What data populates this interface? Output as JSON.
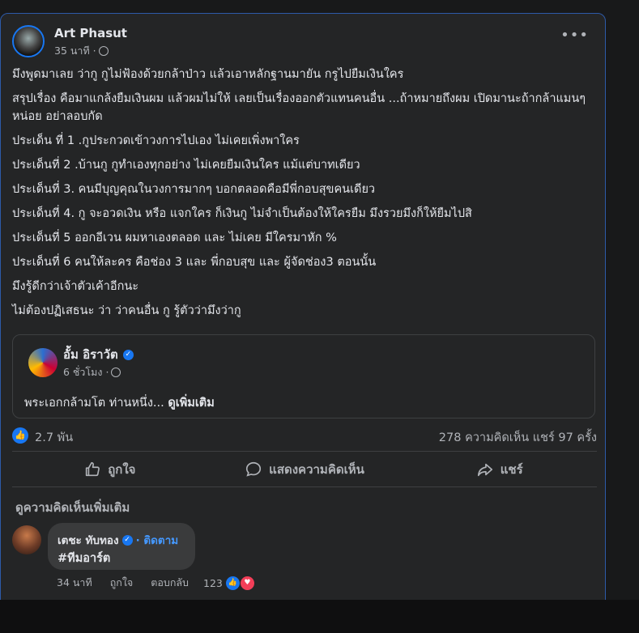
{
  "post": {
    "author": "Art Phasut",
    "time": "35 นาที ·",
    "lines": [
      "มึงพูดมาเลย ว่ากู กูไม่ฟ้องด้วยกล้าป่าว แล้วเอาหลักฐานมายัน กรูไปยืมเงินใคร",
      "สรุปเรื่อง คือมาแกล้งยืมเงินผม แล้วผมไม่ให้ เลยเป็นเรื่องออกตัวแทนคนอื่น ...ถ้าหมายถึงผม เปิดมานะถ้ากล้าแมนๆ หน่อย อย่าลอบกัด",
      "ประเด็น ที่ 1 .กูประกวดเข้าวงการไปเอง ไม่เคยเพิ่งพาใคร",
      "ประเด็นที่ 2 .บ้านกู กูทำเองทุกอย่าง ไม่เคยยืมเงินใคร แม้แต่บาทเดียว",
      "ประเด็นที่ 3. คนมีบุญคุณในวงการมากๆ บอกตลอดคือมีพี่กอบสุขคนเดียว",
      "ประเด็นที่ 4. กู จะอวดเงิน หรือ แจกใคร ก็เงินกู ไม่จำเป็นต้องให้ใครยืม มึงรวยมึงก็ให้ยืมไปสิ",
      "ประเด็นที่ 5 ออกอีเวน ผมหาเองตลอด และ ไม่เคย มีใครมาหัก %",
      "ประเด็นที่ 6 คนให้ละคร คือช่อง 3 และ พี่กอบสุข และ ผู้จัดช่อง3 ตอนนั้น",
      "มึงรู้ดีกว่าเจ้าตัวเค้าอีกนะ",
      "ไม่ต้องปฏิเสธนะ ว่า ว่าคนอื่น กู รู้ตัวว่ามึงว่ากู"
    ]
  },
  "shared": {
    "name": "อั้ม อิราวัต",
    "time": "6 ชั่วโมง ·",
    "text": "พระเอกกล้ามโต ท่านหนึ่ง...",
    "see_more": "ดูเพิ่มเติม"
  },
  "stats": {
    "likes": "2.7 พัน",
    "comments_shares": "278 ความคิดเห็น   แชร์ 97 ครั้ง"
  },
  "actions": {
    "like": "ถูกใจ",
    "comment": "แสดงความคิดเห็น",
    "share": "แชร์"
  },
  "comments": {
    "view_more": "ดูความคิดเห็นเพิ่มเติม",
    "items": [
      {
        "name": "เตชะ ทับทอง",
        "follow": "· ติดตาม",
        "text": "#ทีมอาร์ต",
        "time": "34 นาที",
        "like": "ถูกใจ",
        "reply": "ตอบกลับ",
        "reactions": "123"
      }
    ]
  },
  "icons": [
    "globe-icon",
    "more-options-icon",
    "verified-icon",
    "like-icon",
    "comment-icon",
    "share-icon",
    "love-icon"
  ],
  "colors": {
    "accent": "#1877f2",
    "card": "#242526",
    "love": "#f33e58"
  }
}
